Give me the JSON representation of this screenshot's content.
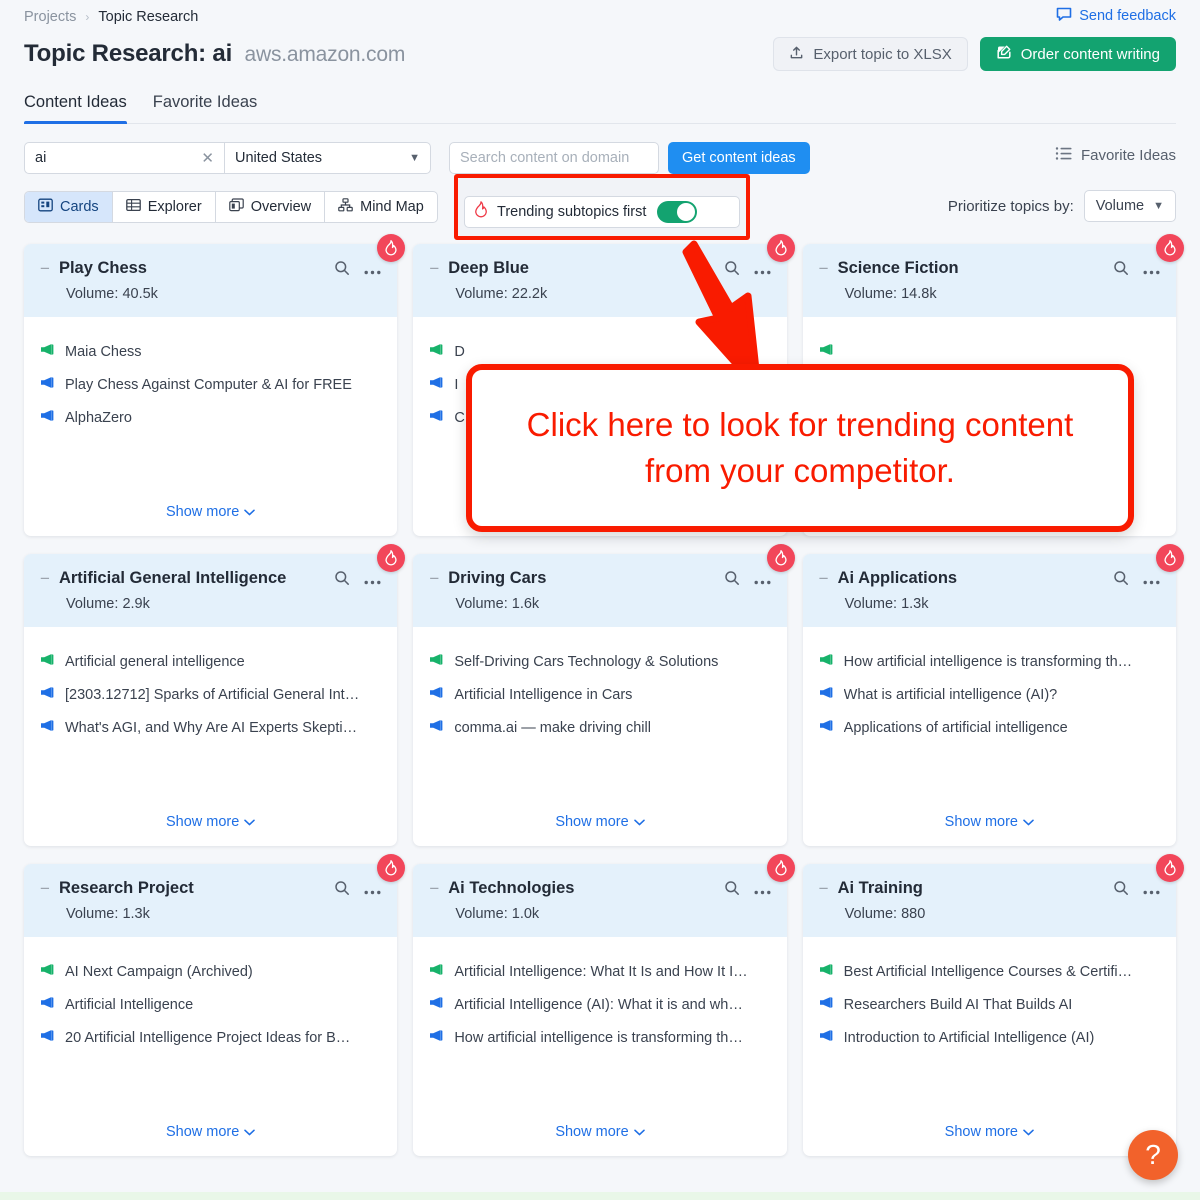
{
  "breadcrumb": {
    "root": "Projects",
    "separator": "›",
    "current": "Topic Research"
  },
  "header": {
    "title_prefix": "Topic Research:",
    "keyword": "ai",
    "domain": "aws.amazon.com",
    "send_feedback": "Send feedback",
    "export_button": "Export topic to XLSX",
    "order_button": "Order content writing"
  },
  "tabs": [
    {
      "label": "Content Ideas",
      "active": true
    },
    {
      "label": "Favorite Ideas",
      "active": false
    }
  ],
  "toolbar": {
    "keyword_value": "ai",
    "clear_icon": "✕",
    "database": "United States",
    "domain_placeholder": "Search content on domain",
    "domain_value": "",
    "get_ideas_button": "Get content ideas",
    "favorite_ideas": "Favorite Ideas",
    "views": [
      {
        "label": "Cards",
        "active": true
      },
      {
        "label": "Explorer",
        "active": false
      },
      {
        "label": "Overview",
        "active": false
      },
      {
        "label": "Mind Map",
        "active": false
      }
    ],
    "trending_label": "Trending subtopics first",
    "trending_on": true,
    "prioritize_label": "Prioritize topics by:",
    "prioritize_value": "Volume"
  },
  "annotation": {
    "text": "Click here to look for trending content from your competitor.",
    "color": "#f91b00"
  },
  "colors": {
    "accent_blue": "#1f6fe5",
    "primary_blue": "#1f8ef1",
    "green": "#13a370",
    "flame_red": "#f2465a",
    "help_orange": "#f2622b",
    "card_head": "#e4f1fb"
  },
  "volume_prefix": "Volume:",
  "show_more_label": "Show more",
  "cards": [
    {
      "title": "Play Chess",
      "volume": "40.5k",
      "trending": true,
      "ideas": [
        {
          "text": "Maia Chess",
          "color": "green"
        },
        {
          "text": "Play Chess Against Computer & AI for FREE",
          "color": "blue"
        },
        {
          "text": "AlphaZero",
          "color": "blue"
        }
      ]
    },
    {
      "title": "Deep Blue",
      "volume": "22.2k",
      "trending": true,
      "ideas": [
        {
          "text": "D",
          "color": "green"
        },
        {
          "text": "I",
          "color": "blue"
        },
        {
          "text": "C",
          "color": "blue"
        }
      ]
    },
    {
      "title": "Science Fiction",
      "volume": "14.8k",
      "trending": true,
      "ideas": [
        {
          "text": "",
          "color": "green"
        },
        {
          "text": "",
          "color": "blue"
        },
        {
          "text": "",
          "color": "blue"
        }
      ]
    },
    {
      "title": "Artificial General Intelligence",
      "volume": "2.9k",
      "trending": true,
      "ideas": [
        {
          "text": "Artificial general intelligence",
          "color": "green"
        },
        {
          "text": "[2303.12712] Sparks of Artificial General Int…",
          "color": "blue"
        },
        {
          "text": "What's AGI, and Why Are AI Experts Skepti…",
          "color": "blue"
        }
      ]
    },
    {
      "title": "Driving Cars",
      "volume": "1.6k",
      "trending": true,
      "ideas": [
        {
          "text": "Self-Driving Cars Technology & Solutions",
          "color": "green"
        },
        {
          "text": "Artificial Intelligence in Cars",
          "color": "blue"
        },
        {
          "text": "comma.ai — make driving chill",
          "color": "blue"
        }
      ]
    },
    {
      "title": "Ai Applications",
      "volume": "1.3k",
      "trending": true,
      "ideas": [
        {
          "text": "How artificial intelligence is transforming th…",
          "color": "green"
        },
        {
          "text": "What is artificial intelligence (AI)?",
          "color": "blue"
        },
        {
          "text": "Applications of artificial intelligence",
          "color": "blue"
        }
      ]
    },
    {
      "title": "Research Project",
      "volume": "1.3k",
      "trending": true,
      "ideas": [
        {
          "text": "AI Next Campaign (Archived)",
          "color": "green"
        },
        {
          "text": "Artificial Intelligence",
          "color": "blue"
        },
        {
          "text": "20 Artificial Intelligence Project Ideas for B…",
          "color": "blue"
        }
      ]
    },
    {
      "title": "Ai Technologies",
      "volume": "1.0k",
      "trending": true,
      "ideas": [
        {
          "text": "Artificial Intelligence: What It Is and How It I…",
          "color": "green"
        },
        {
          "text": "Artificial Intelligence (AI): What it is and wh…",
          "color": "blue"
        },
        {
          "text": "How artificial intelligence is transforming th…",
          "color": "blue"
        }
      ]
    },
    {
      "title": "Ai Training",
      "volume": "880",
      "trending": true,
      "ideas": [
        {
          "text": "Best Artificial Intelligence Courses & Certifi…",
          "color": "green"
        },
        {
          "text": "Researchers Build AI That Builds AI",
          "color": "blue"
        },
        {
          "text": "Introduction to Artificial Intelligence (AI)",
          "color": "blue"
        }
      ]
    }
  ],
  "help_button": "?"
}
